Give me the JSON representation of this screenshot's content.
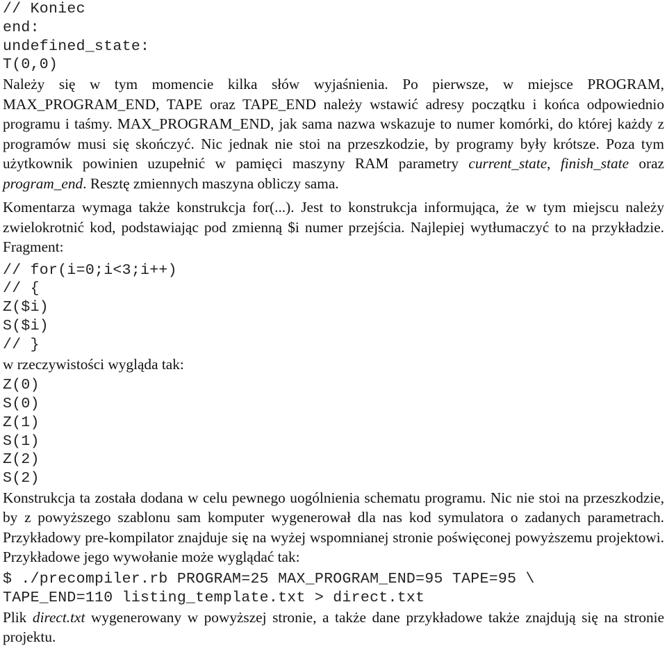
{
  "code_block_1": [
    "// Koniec",
    "end:",
    "undefined_state:",
    "T(0,0)"
  ],
  "paragraph_1": {
    "text_a": "Należy się w tym momencie kilka słów wyjaśnienia. Po pierwsze, w miejsce PROGRAM, MAX_PROGRAM_END, TAPE oraz TAPE_END należy wstawić adresy początku i końca odpowiednio programu i taśmy. MAX_PROGRAM_END, jak sama nazwa wskazuje to numer komórki, do której każdy z programów musi się skończyć. Nic jednak nie stoi na przeszkodzie, by programy były krótsze. Poza tym użytkownik powinien uzupełnić w pamięci maszyny RAM parametry ",
    "em_1": "current_state",
    "sep_1": ", ",
    "em_2": "finish_state",
    "sep_2": " oraz ",
    "em_3": "program_end",
    "text_b": ". Resztę zmiennych maszyna obliczy sama."
  },
  "paragraph_2": "Komentarza wymaga także konstrukcja for(...). Jest to konstrukcja informująca, że w tym miejscu należy zwielokrotnić kod, podstawiając pod zmienną $i numer przejścia. Najlepiej wytłumaczyć to na przykładzie. Fragment:",
  "code_block_2": [
    "// for(i=0;i<3;i++)",
    "// {",
    "Z($i)",
    "S($i)",
    "// }"
  ],
  "paragraph_3": "w rzeczywistości wygląda tak:",
  "code_block_3": [
    "Z(0)",
    "S(0)",
    "Z(1)",
    "S(1)",
    "Z(2)",
    "S(2)"
  ],
  "paragraph_4": "Konstrukcja ta została dodana w celu pewnego uogólnienia schematu programu. Nic nie stoi na przeszkodzie, by z powyższego szablonu sam komputer wygenerował dla nas kod symulatora o zadanych parametrach. Przykładowy pre-kompilator znajduje się na wyżej wspomnianej stronie poświęconej powyższemu projektowi. Przykładowe jego wywołanie może wyglądać tak:",
  "code_block_4": [
    "$ ./precompiler.rb PROGRAM=25 MAX_PROGRAM_END=95 TAPE=95 \\",
    "TAPE_END=110 listing_template.txt > direct.txt"
  ],
  "paragraph_5": {
    "prefix": "Plik ",
    "em_file": "direct.txt",
    "suffix": " wygenerowany w powyższej stronie, a także dane przykładowe także znajdują się na stronie projektu."
  }
}
